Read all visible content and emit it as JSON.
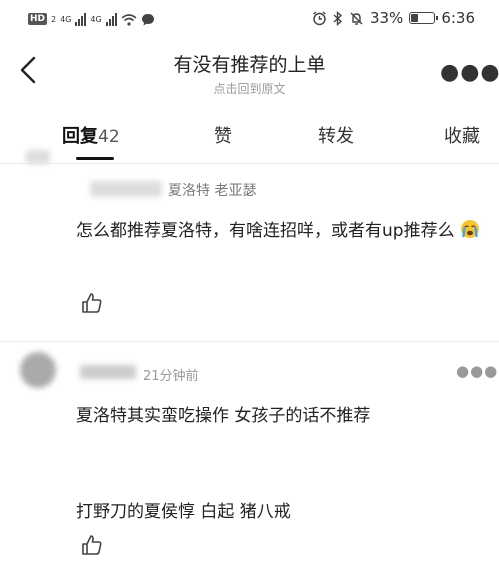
{
  "status_bar": {
    "hd_label": "HD",
    "sim_index": "2",
    "net1": "4G",
    "net2": "4G",
    "battery": "33%",
    "battery_level": 0.33,
    "time": "6:36"
  },
  "header": {
    "title": "有没有推荐的上单",
    "subtitle": "点击回到原文"
  },
  "tabs": [
    {
      "label": "回复",
      "count": "42"
    },
    {
      "label": "赞"
    },
    {
      "label": "转发"
    },
    {
      "label": "收藏"
    }
  ],
  "quoted_comment": {
    "mentions": "夏洛特 老亚瑟",
    "text": "怎么都推荐夏洛特，有啥连招咩，或者有up推荐么",
    "emoji": "crying-face"
  },
  "comment": {
    "time": "21分钟前",
    "line1": "夏洛特其实蛮吃操作 女孩子的话不推荐",
    "line2": "打野刀的夏侯惇 白起 猪八戒"
  }
}
